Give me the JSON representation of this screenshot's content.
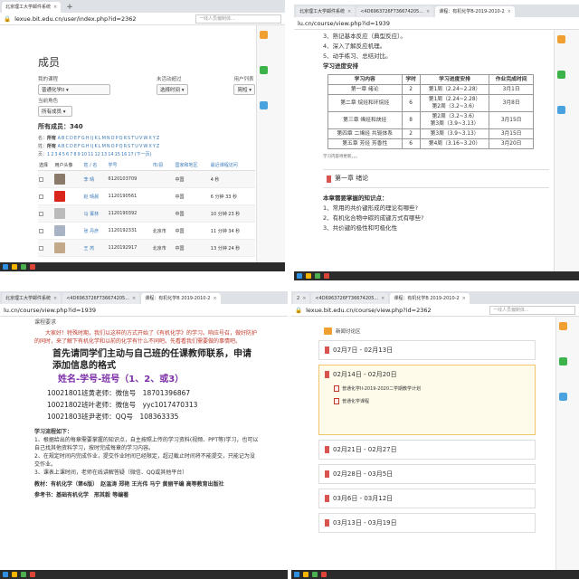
{
  "q1": {
    "tabs": [
      {
        "label": "北京理工大学邮件系统"
      }
    ],
    "address": "lexue.bit.edu.cn/user/index.php?id=2362",
    "search_placeholder": "一线人员偏制体...",
    "page_title": "成员",
    "filters": {
      "my_course_label": "我的课程",
      "my_course_value": "普通化学II",
      "inactive_label": "未活动超过",
      "inactive_value": "选择时间",
      "user_list_label": "用户列表",
      "user_list_value": "简短",
      "role_label": "当前角色",
      "role_value": "所有成员"
    },
    "member_count_label": "所有成员：",
    "member_count": "340",
    "first_name_label": "名：",
    "last_name_label": "姓：",
    "all_label": "所有",
    "letters": [
      "A",
      "B",
      "C",
      "D",
      "E",
      "F",
      "G",
      "H",
      "I",
      "J",
      "K",
      "L",
      "M",
      "N",
      "O",
      "P",
      "Q",
      "R",
      "S",
      "T",
      "U",
      "V",
      "W",
      "X",
      "Y",
      "Z"
    ],
    "pages_label": "页：",
    "pages": [
      "1",
      "2",
      "3",
      "4",
      "5",
      "6",
      "7",
      "8",
      "9",
      "10",
      "11",
      "12",
      "13",
      "14",
      "15",
      "16",
      "17",
      "(下一页)"
    ],
    "columns": [
      "选择",
      "用户头像",
      "姓 / 名",
      "学号",
      "市/县",
      "国家和地区",
      "最近课程访问"
    ],
    "rows": [
      {
        "name": "李 晴",
        "id": "6120103709",
        "city": "",
        "country": "中国",
        "last": "4 秒",
        "avatar": "#8a7a6a"
      },
      {
        "name": "赵 晴晨",
        "id": "1120190561",
        "city": "",
        "country": "中国",
        "last": "6 分钟 33 秒",
        "avatar": "#d9261c"
      },
      {
        "name": "马 菁林",
        "id": "1120190392",
        "city": "",
        "country": "中国",
        "last": "10 分钟 23 秒",
        "avatar": "#bbbbbb"
      },
      {
        "name": "张 丹彦",
        "id": "1120192331",
        "city": "北京市",
        "country": "中国",
        "last": "11 分钟 34 秒",
        "avatar": "#a8b4c4"
      },
      {
        "name": "王 芮",
        "id": "1120192917",
        "city": "北京市",
        "country": "中国",
        "last": "13 分钟 24 秒",
        "avatar": "#c4a88a"
      }
    ]
  },
  "q2": {
    "tabs": [
      {
        "label": "北京理工大学邮件系统"
      },
      {
        "label": "<4D6963726F736674205..."
      },
      {
        "label": "课程：有机化学B-2019-2010-2"
      }
    ],
    "address": "lu.cn/course/view.php?id=1939",
    "list": [
      "3、熟记基本反应（典型反应）。",
      "4、深入了解反应机理。",
      "5、动手练习、总结对比。"
    ],
    "schedule_title": "学习进度安排",
    "schedule_cols": [
      "学习内容",
      "学时",
      "学习进度安排",
      "作业完成时间"
    ],
    "schedule_rows": [
      {
        "content": "第一章 绪论",
        "hours": "2",
        "plan": "第1周（2.24~2.28）",
        "due": "3月1日"
      },
      {
        "content": "第二章 烷烃和环烷烃",
        "hours": "6",
        "plan": "第1周（2.24~2.28）\n第2周（3.2~3.6）",
        "due": "3月8日"
      },
      {
        "content": "第三章 烯烃和炔烃",
        "hours": "8",
        "plan": "第2周（3.2~3.6）\n第3周（3.9~3.13）",
        "due": "3月15日"
      },
      {
        "content": "第四章 二烯烃 共轭体系",
        "hours": "2",
        "plan": "第3周（3.9~3.13）",
        "due": "3月15日"
      },
      {
        "content": "第五章 芳烃 芳香性",
        "hours": "6",
        "plan": "第4周（3.16~3.20）",
        "due": "3月20日"
      }
    ],
    "schedule_note": "学习内容待更新。。。",
    "chapter_heading": "第一章 绪论",
    "knowledge_title": "本章需要掌握的知识点：",
    "knowledge": [
      "1、常用的共价键形成的理论有哪些?",
      "2、有机化合物中碳的成键方式有哪些?",
      "3、共价键的极性和可极化性"
    ]
  },
  "q3": {
    "tabs": [
      {
        "label": "北京理工大学邮件系统"
      },
      {
        "label": "<4D6963726F736674205..."
      },
      {
        "label": "课程：有机化学B 2019-2010-2"
      }
    ],
    "address": "lu.cn/course/view.php?id=1939",
    "section_label": "课程要求",
    "intro": "大家好！特殊时期，我们以这样的方式开始了《有机化学》的学习。响应号召，做好防护的同时，来了解下有机化学和以前的化学有什么不同吧。先看看我们需要做的事情吧。",
    "lead_title": "首先请同学们主动与自己班的任课教师联系，申请添加信息的格式",
    "format": "姓名-学号-班号（1、2、或3）",
    "contacts": [
      "10021801班黄老师：微信号　18701396867",
      "10021802班叶老师：微信号　yyc1017470313",
      "10021803班尹老师：QQ号　108363335"
    ],
    "flow_title": "学习流程如下：",
    "flow": [
      "1、根据给出的每章需要掌握的知识点，自主按照上传的学习资料(视频、PPT等)学习，也可以自己找其他资料学习，按时完成每章的学习内容。",
      "2、在规定时间内完成作业，提交作业时间已经限定，超过截止时间将不能提交，只能记为没交作业。",
      "3、课表上课时间，老师在线讲解答疑（微信、QQ或其他平台）"
    ],
    "textbook": "教材：有机化学（第6版）　赵温涛 郑艳 王光伟 马宁 黄丽平编 高等教育出版社",
    "reference": "参考书：基础有机化学　邢其毅 等编著"
  },
  "q4": {
    "tabs": [
      {
        "label": "2"
      },
      {
        "label": "<4D6963726F736674205..."
      },
      {
        "label": "课程：有机化学B 2019-2010-2"
      }
    ],
    "address": "lexue.bit.edu.cn/course/view.php?id=2362",
    "search_placeholder": "一线人员偏制体...",
    "forum_label": "新闻讨论区",
    "weeks": [
      "02月7日 - 02月13日",
      "02月14日 - 02月20日",
      "02月21日 - 02月27日",
      "02月28日 - 03月5日",
      "03月6日 - 03月12日",
      "03月13日 - 03月19日"
    ],
    "resources": [
      "普通化学II-2019-2020二学期教学计划",
      "普通化学课程"
    ]
  }
}
